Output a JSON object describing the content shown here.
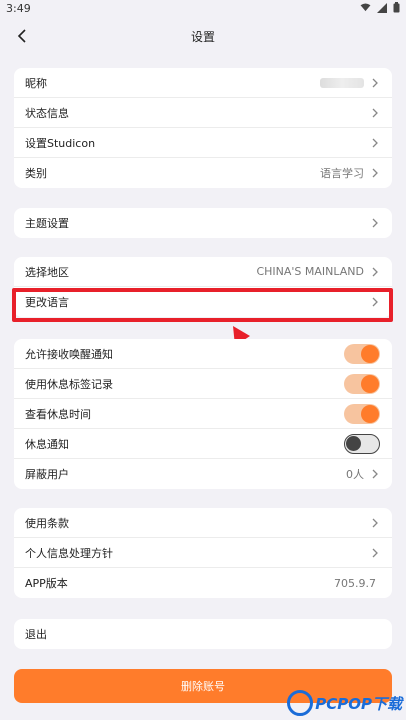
{
  "status_bar": {
    "time": "3:49"
  },
  "header": {
    "title": "设置"
  },
  "group_profile": [
    {
      "label": "昵称",
      "value": ""
    },
    {
      "label": "状态信息",
      "value": ""
    },
    {
      "label": "设置Studicon",
      "value": ""
    },
    {
      "label": "类别",
      "value": "语言学习"
    }
  ],
  "group_theme": [
    {
      "label": "主题设置"
    }
  ],
  "group_region": [
    {
      "label": "选择地区",
      "value": "CHINA'S MAINLAND"
    },
    {
      "label": "更改语言",
      "value": ""
    }
  ],
  "group_notify": [
    {
      "label": "允许接收唤醒通知",
      "state": "on"
    },
    {
      "label": "使用休息标签记录",
      "state": "on"
    },
    {
      "label": "查看休息时间",
      "state": "on"
    },
    {
      "label": "休息通知",
      "state": "off"
    },
    {
      "label": "屏蔽用户",
      "value": "0人"
    }
  ],
  "group_about": [
    {
      "label": "使用条款"
    },
    {
      "label": "个人信息处理方针"
    },
    {
      "label": "APP版本",
      "value": "705.9.7"
    }
  ],
  "group_logout": [
    {
      "label": "退出"
    }
  ],
  "delete_button": {
    "label": "删除账号"
  },
  "watermark": {
    "text": "PCPOP下载"
  },
  "colors": {
    "accent": "#ff7c2b",
    "highlight": "#e8202a",
    "background": "#f2f1f6"
  }
}
